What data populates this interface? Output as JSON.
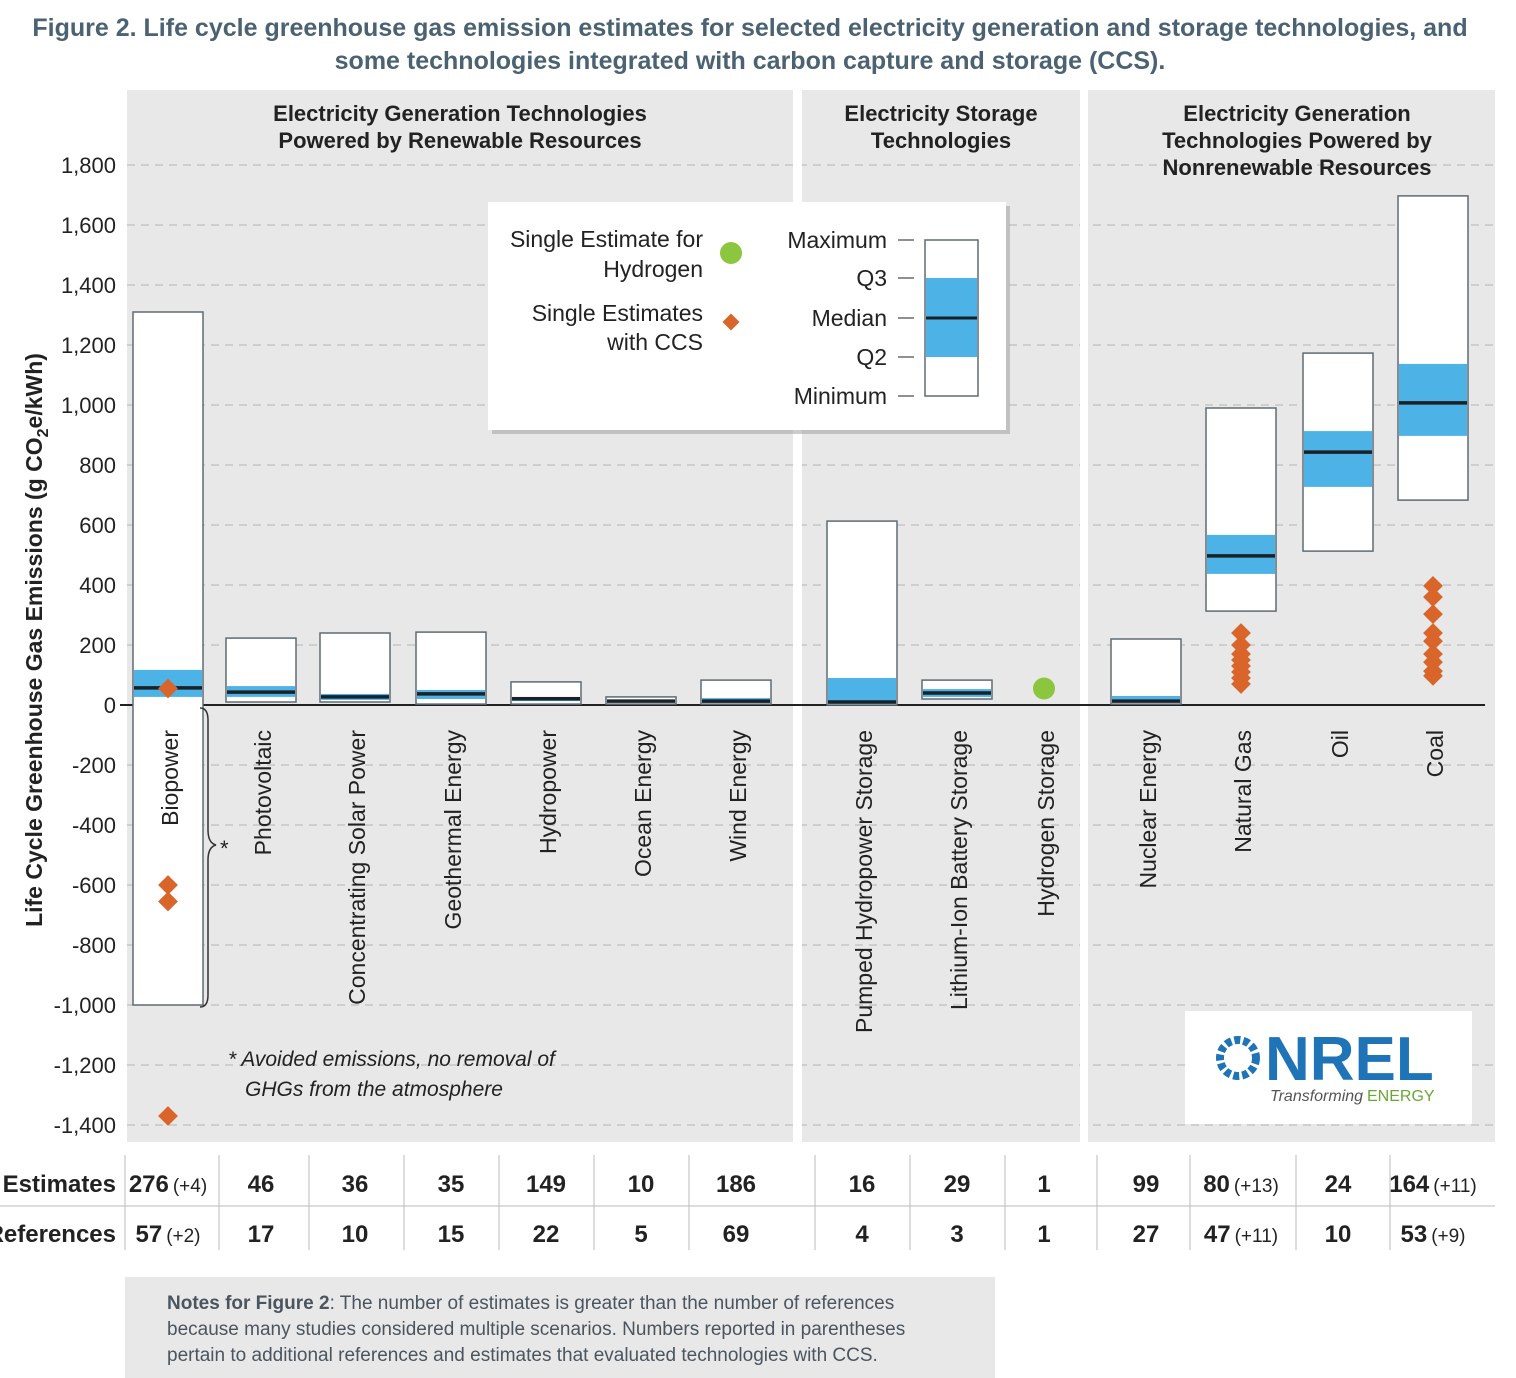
{
  "title": "Figure 2. Life cycle greenhouse gas emission estimates for selected electricity generation and storage technologies, and some technologies integrated with carbon capture and storage (CCS).",
  "chart_data": {
    "type": "box",
    "ylabel": "Life Cycle Greenhouse Gas Emissions (g CO2e/kWh)",
    "ylim": [
      -1400,
      1800
    ],
    "yticks": [
      1800,
      1600,
      1400,
      1200,
      1000,
      800,
      600,
      400,
      200,
      0,
      -200,
      -400,
      -600,
      -800,
      -1000,
      -1200,
      -1400
    ],
    "ytick_labels": [
      "1,800",
      "1,600",
      "1,400",
      "1,200",
      "1,000",
      "800",
      "600",
      "400",
      "200",
      "0",
      "-200",
      "-400",
      "-600",
      "-800",
      "-1,000",
      "-1,200",
      "-1,400"
    ],
    "grid": true,
    "groups": [
      {
        "label": "Electricity Generation Technologies Powered by Renewable Resources",
        "categories": [
          "Biopower",
          "Photovoltaic",
          "Concentrating Solar Power",
          "Geothermal Energy",
          "Hydropower",
          "Ocean Energy",
          "Wind Energy"
        ]
      },
      {
        "label": "Electricity Storage Technologies",
        "categories": [
          "Pumped Hydropower Storage",
          "Lithium-Ion Battery Storage",
          "Hydrogen Storage"
        ]
      },
      {
        "label": "Electricity Generation Technologies Powered by Nonrenewable Resources",
        "categories": [
          "Nuclear Energy",
          "Natural Gas",
          "Oil",
          "Coal"
        ]
      }
    ],
    "series": [
      {
        "category": "Biopower",
        "min": -1000,
        "q1": 27,
        "median": 57,
        "q3": 117,
        "max": 1310,
        "ccs": [
          55,
          -600,
          -655,
          -1370
        ],
        "estimates": "276",
        "estimates_ccs": "(+4)",
        "references": "57",
        "references_ccs": "(+2)"
      },
      {
        "category": "Photovoltaic",
        "min": 10,
        "q1": 27,
        "median": 43,
        "q3": 63,
        "max": 223,
        "estimates": "46",
        "references": "17"
      },
      {
        "category": "Concentrating Solar Power",
        "min": 10,
        "q1": 17,
        "median": 27,
        "q3": 37,
        "max": 240,
        "estimates": "36",
        "references": "10"
      },
      {
        "category": "Geothermal Energy",
        "min": 3,
        "q1": 20,
        "median": 37,
        "q3": 50,
        "max": 243,
        "estimates": "35",
        "references": "15"
      },
      {
        "category": "Hydropower",
        "min": 3,
        "q1": 13,
        "median": 21,
        "q3": 27,
        "max": 77,
        "estimates": "149",
        "references": "22"
      },
      {
        "category": "Ocean Energy",
        "min": 3,
        "q1": 10,
        "median": 13,
        "q3": 17,
        "max": 27,
        "estimates": "10",
        "references": "5"
      },
      {
        "category": "Wind Energy",
        "min": 3,
        "q1": 7,
        "median": 13,
        "q3": 23,
        "max": 83,
        "estimates": "186",
        "references": "69"
      },
      {
        "category": "Pumped Hydropower Storage",
        "min": 0,
        "q1": 3,
        "median": 10,
        "q3": 90,
        "max": 613,
        "estimates": "16",
        "references": "4"
      },
      {
        "category": "Lithium-Ion Battery Storage",
        "min": 20,
        "q1": 27,
        "median": 40,
        "q3": 53,
        "max": 83,
        "estimates": "29",
        "references": "3"
      },
      {
        "category": "Hydrogen Storage",
        "single": 55,
        "estimates": "1",
        "references": "1"
      },
      {
        "category": "Nuclear Energy",
        "min": 3,
        "q1": 10,
        "median": 13,
        "q3": 30,
        "max": 220,
        "estimates": "99",
        "references": "27"
      },
      {
        "category": "Natural Gas",
        "min": 313,
        "q1": 437,
        "median": 497,
        "q3": 567,
        "max": 990,
        "ccs": [
          240,
          200,
          170,
          150,
          130,
          110,
          90,
          70
        ],
        "estimates": "80",
        "estimates_ccs": "(+13)",
        "references": "47",
        "references_ccs": "(+11)"
      },
      {
        "category": "Oil",
        "min": 513,
        "q1": 727,
        "median": 843,
        "q3": 913,
        "max": 1173,
        "estimates": "24",
        "references": "10"
      },
      {
        "category": "Coal",
        "min": 683,
        "q1": 897,
        "median": 1007,
        "q3": 1137,
        "max": 1697,
        "ccs": [
          397,
          360,
          303,
          240,
          213,
          170,
          143,
          113,
          97
        ],
        "estimates": "164",
        "estimates_ccs": "(+11)",
        "references": "53",
        "references_ccs": "(+9)"
      }
    ],
    "legend": {
      "single_h2": "Single Estimate for Hydrogen",
      "single_ccs": "Single Estimates with CCS",
      "maximum": "Maximum",
      "q3": "Q3",
      "median": "Median",
      "q2": "Q2",
      "minimum": "Minimum"
    },
    "annotation": "* Avoided emissions, no removal of GHGs from the atmosphere",
    "row_labels": {
      "estimates": "Estimates",
      "references": "References"
    },
    "colors": {
      "iqr": "#4db3e6",
      "h2": "#8cc63f",
      "ccs": "#d9652b",
      "panel": "#e8e8e8"
    }
  },
  "logo": {
    "text": "NREL",
    "tagline": "Transforming",
    "tagline2": "ENERGY"
  },
  "notes": {
    "bold": "Notes for Figure 2",
    "text": ": The number of estimates is greater than the number of references because many studies considered multiple scenarios. Numbers reported in parentheses pertain to additional references and estimates that evaluated technologies with CCS."
  }
}
